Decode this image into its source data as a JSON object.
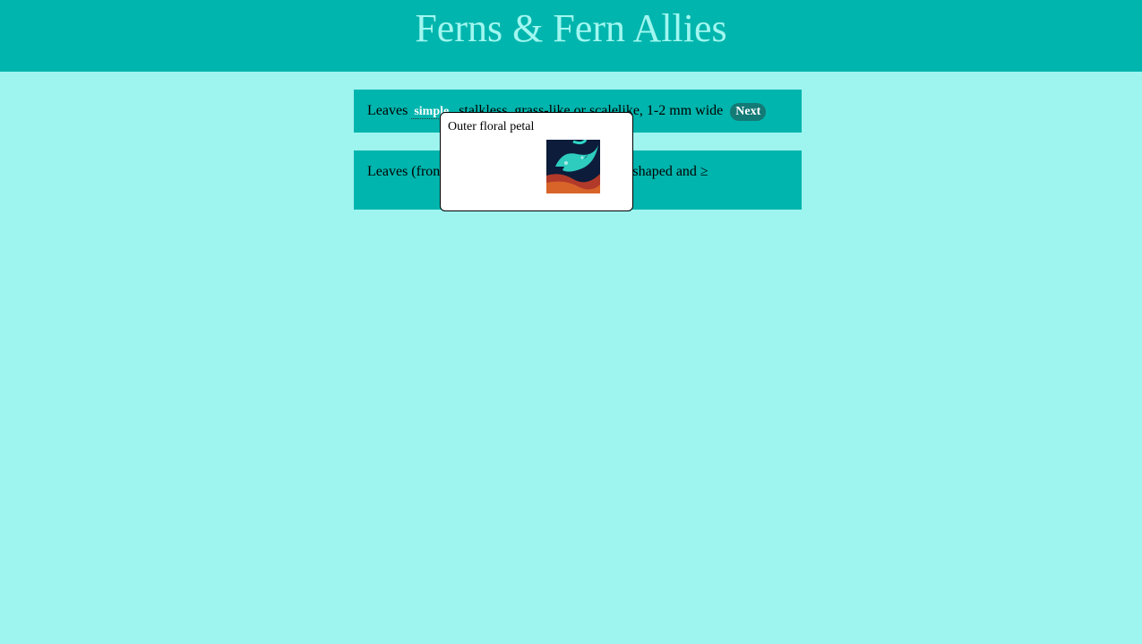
{
  "header": {
    "title": "Ferns & Fern Allies"
  },
  "choices": [
    {
      "prefix": "Leaves",
      "term": "simple",
      "suffix": ", stalkless, grass-like or scalelike, 1-2 mm wide",
      "next_label": "Next"
    },
    {
      "text": "Leaves (fronds) with stalks (stipes), variously shaped and ≥"
    }
  ],
  "tooltip": {
    "text": "Outer floral petal",
    "image_icon": "petal-thumbnail"
  },
  "colors": {
    "background": "#9ef5f0",
    "header": "#00b5ad",
    "header_text": "#a0f7f0",
    "next_button": "#137a76"
  }
}
